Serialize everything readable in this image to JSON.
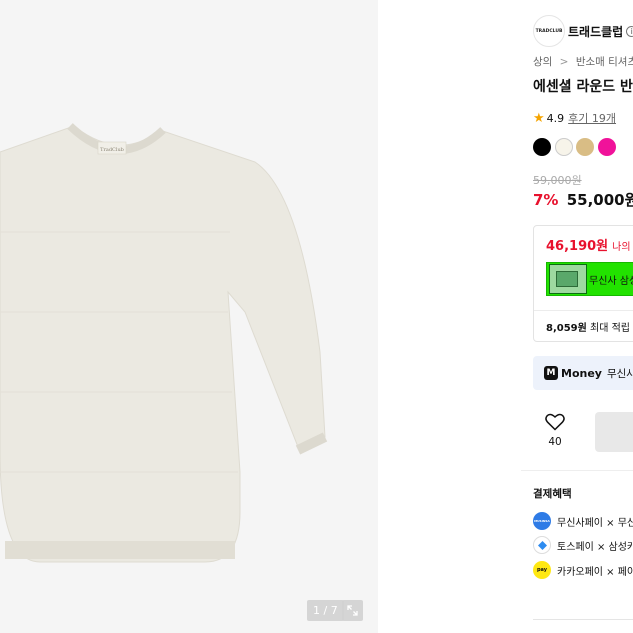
{
  "gallery": {
    "shirt_tag": "TradClub",
    "counter": "1 / 7"
  },
  "brand": {
    "logo_text": "TRADCLUB",
    "name": "트래드클럽",
    "info_icon": "i"
  },
  "breadcrumb": [
    "상의",
    "반소매 티셔츠"
  ],
  "breadcrumb_sep": ">",
  "product": {
    "title": "에센셜 라운드 반",
    "star_icon": "★",
    "rating": "4.9",
    "reviews": "후기 19개",
    "colors": [
      "#000000",
      "#f7f4ea",
      "#d9bd85",
      "#f0129a"
    ],
    "original_price": "59,000원",
    "discount": "7%",
    "price": "55,000원"
  },
  "benefit": {
    "max_price": "46,190원",
    "max_price_suffix": "나의",
    "card_text": "무신사 삼성",
    "points_amount": "8,059원",
    "points_text": "최대 적립"
  },
  "money": {
    "icon": "M",
    "brand": "Money",
    "text": "무신사머"
  },
  "like": {
    "count": "40"
  },
  "payment": {
    "title": "결제혜택",
    "rows": [
      {
        "text": "무신사페이 × 무신",
        "icon_label": "MUSINSA",
        "color": "#2e7be6"
      },
      {
        "text": "토스페이 × 삼성카",
        "icon_label": "toss",
        "color": "#ffffff"
      },
      {
        "text": "카카오페이 × 페이",
        "icon_label": "pay",
        "color": "#ffe812"
      }
    ]
  }
}
